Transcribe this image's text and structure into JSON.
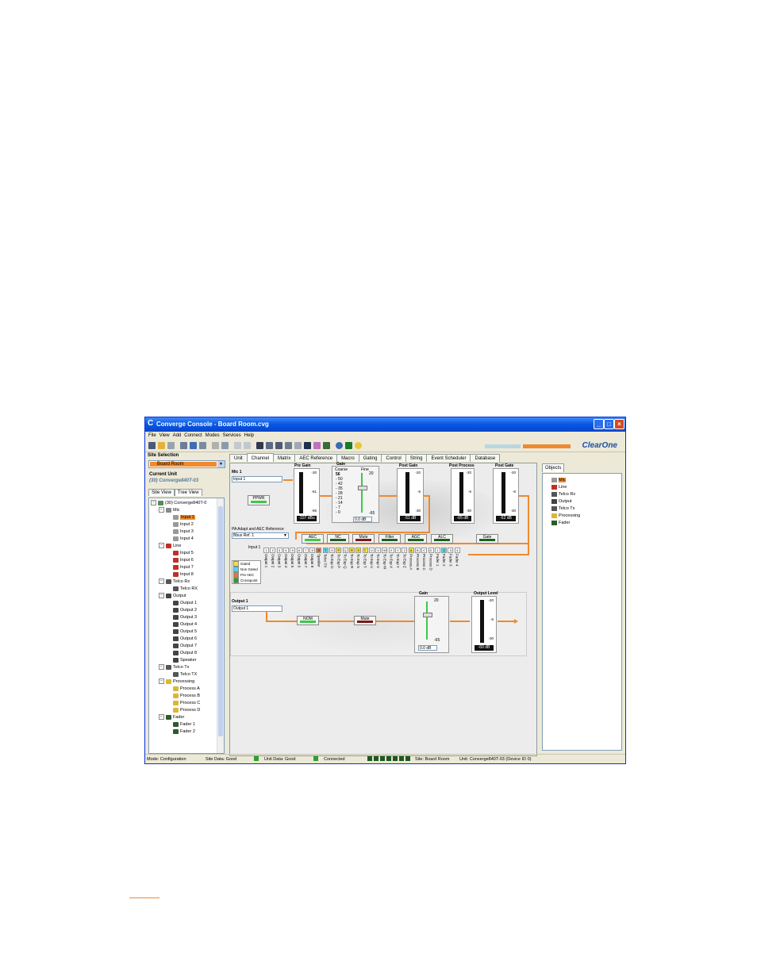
{
  "window": {
    "title": "Converge Console - Board Room.cvg",
    "controls": {
      "minimize": "_",
      "maximize": "□",
      "close": "×"
    }
  },
  "menu": [
    "File",
    "View",
    "Add",
    "Connect",
    "Modes",
    "Services",
    "Help"
  ],
  "brand": {
    "name": "ClearOne",
    "color": "#1c4fa0",
    "accent": "#ef8a2e"
  },
  "left": {
    "site_selection_label": "Site Selection",
    "site_selected": "Board Room",
    "current_unit_label": "Current Unit",
    "current_unit_value": "(30) Converge840T-03",
    "view_tabs": [
      "Site View",
      "Tree View"
    ],
    "tree": {
      "root": "(30) Converge840T-0",
      "mic": "Mic",
      "mic_items": [
        "Input 1",
        "Input 2",
        "Input 3",
        "Input 4"
      ],
      "line": "Line",
      "line_items": [
        "Input 5",
        "Input 6",
        "Input 7",
        "Input 8"
      ],
      "telco_rx": "Telco Rx",
      "telco_rx_items": [
        "Telco RX"
      ],
      "output": "Output",
      "output_items": [
        "Output 1",
        "Output 2",
        "Output 3",
        "Output 4",
        "Output 5",
        "Output 6",
        "Output 7",
        "Output 8",
        "Speaker"
      ],
      "telco_tx": "Telco Tx",
      "telco_tx_items": [
        "Telco TX"
      ],
      "processing": "Processing",
      "processing_items": [
        "Process A",
        "Process B",
        "Process C",
        "Process D"
      ],
      "fader": "Fader",
      "fader_items": [
        "Fader 1",
        "Fader 2"
      ]
    }
  },
  "tabs": [
    "Unit",
    "Channel",
    "Matrix",
    "AEC Reference",
    "Macro",
    "Gating",
    "Control",
    "String",
    "Event Scheduler",
    "Database"
  ],
  "active_tab": "Channel",
  "channel": {
    "mic_label": "Mic 1",
    "mic_name": "Input 1",
    "ppwr": "PPWR",
    "pre_gain": {
      "title": "Pre Gain",
      "ticks": [
        "-30",
        "-61",
        "-95"
      ],
      "reading": "-107 dBu"
    },
    "gain": {
      "title": "Gain",
      "coarse": "Coarse",
      "coarse_values": [
        "56",
        "- 50",
        "- 42",
        "- 35",
        "- 28",
        "- 21",
        "- 14",
        "- 7",
        "- 0"
      ],
      "fine": "Fine",
      "fine_ticks": [
        "20",
        "-65"
      ],
      "reading": "0.0 dB"
    },
    "post_gain": {
      "title": "Post Gain",
      "ticks": [
        "-20",
        "-6",
        "-30"
      ],
      "reading": "-51 dB"
    },
    "post_process": {
      "title": "Post Process",
      "ticks": [
        "-20",
        "-6",
        "-30"
      ],
      "reading": "-65 dB"
    },
    "post_gate": {
      "title": "Post Gate",
      "ticks": [
        "-20",
        "-6",
        "-30"
      ],
      "reading": "-62 dB"
    },
    "pa_adapt_label": "PA Adapt and AEC Reference",
    "pa_adapt_value": "Bbus Ref. 1",
    "buttons": [
      "AEC",
      "NC",
      "Mute",
      "Filter",
      "AGC",
      "ALC",
      "Gate"
    ],
    "matrix_input_label": "Input 1",
    "matrix_headers": [
      "1",
      "2",
      "3",
      "4",
      "5",
      "6",
      "7",
      "8",
      "S",
      "T",
      "O",
      "P",
      "Q",
      "R",
      "S",
      "T",
      "U",
      "V",
      "W",
      "X",
      "Y",
      "Z",
      "A",
      "B",
      "C",
      "D",
      "1",
      "2",
      "3",
      "4"
    ],
    "matrix_columns": [
      "Output 1",
      "Output 2",
      "Output 3",
      "Output 4",
      "Output 5",
      "Output 6",
      "Output 7",
      "Output 8",
      "Speaker",
      "Telco TX",
      "To Exp O",
      "To Exp P",
      "To Exp Q",
      "To Exp R",
      "To Exp S",
      "To Exp T",
      "To Exp U",
      "To Exp V",
      "To Exp W",
      "To Exp X",
      "To Exp Y",
      "To Exp Z",
      "Process A",
      "Process B",
      "Process C",
      "Process D",
      "Fader 1",
      "Fader 2",
      "Fader 3",
      "Fader 4"
    ],
    "legend": [
      "Gated",
      "Non Gated",
      "Pre AEC",
      "Crosspoint"
    ],
    "legend_colors": [
      "#f3e23c",
      "#4fd8e8",
      "#e07a3c",
      "#2ca02c"
    ],
    "output_label": "Output 1",
    "output_name": "Output 1",
    "output_buttons": [
      "NOM",
      "Mute"
    ],
    "out_gain": {
      "title": "Gain",
      "ticks": [
        "20",
        "-65"
      ],
      "reading": "0.0 dB"
    },
    "out_level": {
      "title": "Output Level",
      "ticks": [
        "-20",
        "-6",
        "-30"
      ],
      "reading": "-60 dB"
    }
  },
  "objects": {
    "tab": "Objects",
    "items": [
      "Mic",
      "Line",
      "Telco Rx",
      "Output",
      "Telco Tx",
      "Processing",
      "Fader"
    ]
  },
  "status": {
    "mode": "Mode: Configuration",
    "site_data": "Site Data: Good",
    "unit_data": "Unit Data: Good",
    "connected": "Connected",
    "site": "Site: Board Room",
    "unit": "Unit: Converge840T-03 (Device ID 0)"
  }
}
